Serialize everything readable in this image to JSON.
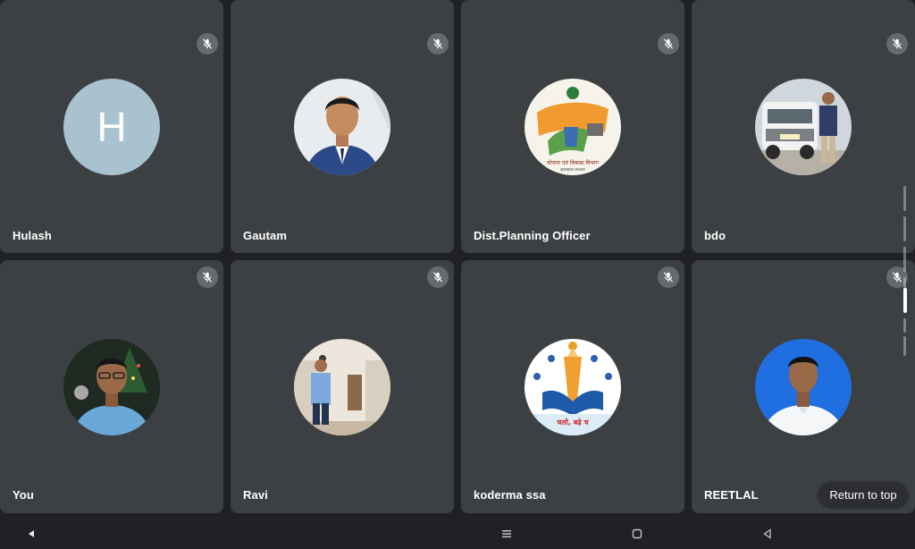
{
  "participants": [
    {
      "name": "Hulash",
      "avatar": "letter",
      "initial": "H",
      "muted": true
    },
    {
      "name": "Gautam",
      "avatar": "photo-man-suit-icon",
      "muted": true
    },
    {
      "name": "Dist.Planning Officer",
      "avatar": "planning-department-logo-icon",
      "muted": true
    },
    {
      "name": "bdo",
      "avatar": "photo-man-with-suv-icon",
      "muted": true
    },
    {
      "name": "You",
      "avatar": "photo-man-glasses-icon",
      "muted": true
    },
    {
      "name": "Ravi",
      "avatar": "photo-man-standing-icon",
      "muted": true
    },
    {
      "name": "koderma ssa",
      "avatar": "education-campaign-logo-icon",
      "muted": true
    },
    {
      "name": "REETLAL",
      "avatar": "photo-man-white-shirt-icon",
      "muted": true
    }
  ],
  "logo_text": {
    "planning": "योजना एवं विकास विभाग",
    "planning_sub": "झारखण्ड सरकार",
    "education": "चलो, बढ़े च"
  },
  "return_to_top_label": "Return to top",
  "colors": {
    "background": "#202124",
    "tile": "#3c4043",
    "letter_avatar": "#a8c2cf",
    "text": "#ffffff"
  },
  "navbar": {
    "back": "back-nav-icon",
    "menu": "menu-nav-icon",
    "home": "home-nav-icon",
    "recent": "recent-nav-icon"
  }
}
